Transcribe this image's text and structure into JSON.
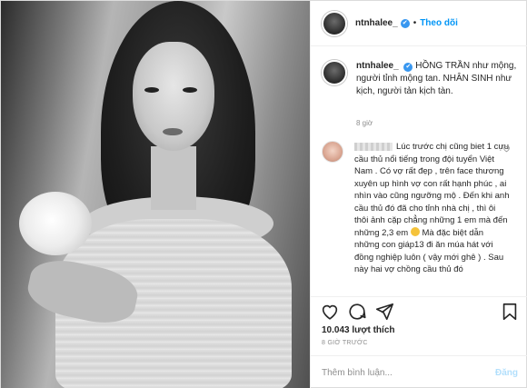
{
  "header": {
    "username": "ntnhalee_",
    "verified_badge": "✔",
    "separator": "•",
    "follow_label": "Theo dõi"
  },
  "caption": {
    "username": "ntnhalee_",
    "verified_badge": "✔",
    "text": "HỒNG TRẦN như mộng, người tỉnh mộng tan. NHÂN SINH như kịch, người tản kịch tàn.",
    "time": "8 giờ"
  },
  "comment": {
    "text_before_emoji": "Lúc trước chị cũng biet 1 cựu cầu thủ nổi tiếng trong đội tuyển Việt Nam . Có vợ rất đẹp , trên face thương xuyên up hình vợ con rất hạnh phúc , ai nhìn vào cũng ngưỡng mộ . Đến khi anh cầu thủ đó đã cho tỉnh nhà chị , thì ôi thôi ảnh cặp chẳng những 1 em mà đến những 2,3 em",
    "text_after_emoji": "Mà đặc biệt dẫn những con giáp13 đi ăn múa hát với đồng nghiệp luôn ( vậy mới ghê ) . Sau này hai vợ chồng cầu thủ đó",
    "icons": {
      "like": "heart-outline-icon",
      "emoji": "face-emoji-icon"
    }
  },
  "actions": {
    "icons": [
      "heart-icon",
      "comment-icon",
      "share-icon",
      "bookmark-icon"
    ]
  },
  "likes": "10.043 lượt thích",
  "post_time": "8 GIỜ TRƯỚC",
  "add_comment": {
    "placeholder": "Thêm bình luận...",
    "post_label": "Đăng"
  },
  "colors": {
    "accent": "#0095f6",
    "verified": "#3897f0",
    "muted": "#8e8e8e"
  }
}
